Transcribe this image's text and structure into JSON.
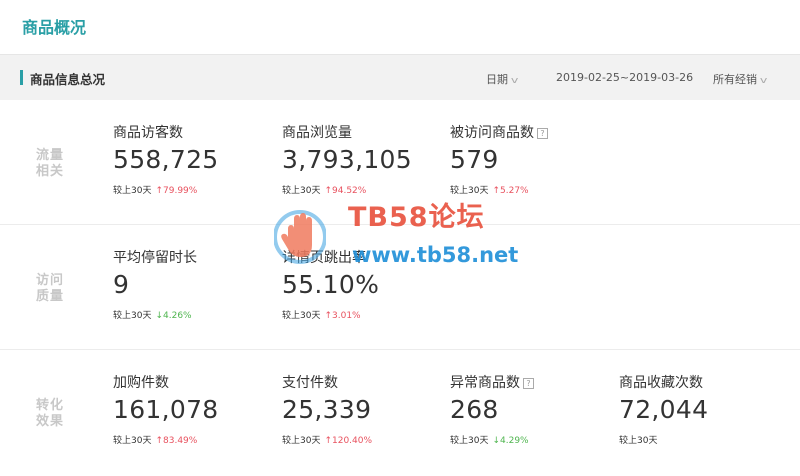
{
  "page": {
    "title": "商品概况"
  },
  "section": {
    "title": "商品信息总况",
    "filters": {
      "date_label": "日期",
      "date_range": "2019-02-25~2019-03-26",
      "dealer_label": "所有经销"
    }
  },
  "groups": [
    {
      "label_line1": "流量",
      "label_line2": "相关",
      "metrics": [
        {
          "name": "商品访客数",
          "value": "558,725",
          "compare_label": "较上30天",
          "change": "79.99%",
          "direction": "up"
        },
        {
          "name": "商品浏览量",
          "value": "3,793,105",
          "compare_label": "较上30天",
          "change": "94.52%",
          "direction": "up"
        },
        {
          "name": "被访问商品数",
          "value": "579",
          "compare_label": "较上30天",
          "change": "5.27%",
          "direction": "up",
          "help": "?"
        }
      ]
    },
    {
      "label_line1": "访问",
      "label_line2": "质量",
      "metrics": [
        {
          "name": "平均停留时长",
          "value": "9",
          "compare_label": "较上30天",
          "change": "4.26%",
          "direction": "down"
        },
        {
          "name": "详情页跳出率",
          "value": "55.10%",
          "compare_label": "较上30天",
          "change": "3.01%",
          "direction": "up"
        }
      ]
    },
    {
      "label_line1": "转化",
      "label_line2": "效果",
      "metrics": [
        {
          "name": "加购件数",
          "value": "161,078",
          "compare_label": "较上30天",
          "change": "83.49%",
          "direction": "up"
        },
        {
          "name": "支付件数",
          "value": "25,339",
          "compare_label": "较上30天",
          "change": "120.40%",
          "direction": "up"
        },
        {
          "name": "异常商品数",
          "value": "268",
          "compare_label": "较上30天",
          "change": "4.29%",
          "direction": "down",
          "help": "?"
        },
        {
          "name": "商品收藏次数",
          "value": "72,044",
          "compare_label": "较上30天",
          "change": "",
          "direction": ""
        }
      ]
    }
  ],
  "watermark": {
    "line1": "TB58论坛",
    "line2": "www.tb58.net"
  },
  "arrows": {
    "up": "↑",
    "down": "↓"
  },
  "colors": {
    "accent": "#2a9fa6",
    "up": "#e8525f",
    "down": "#4fb54f"
  }
}
